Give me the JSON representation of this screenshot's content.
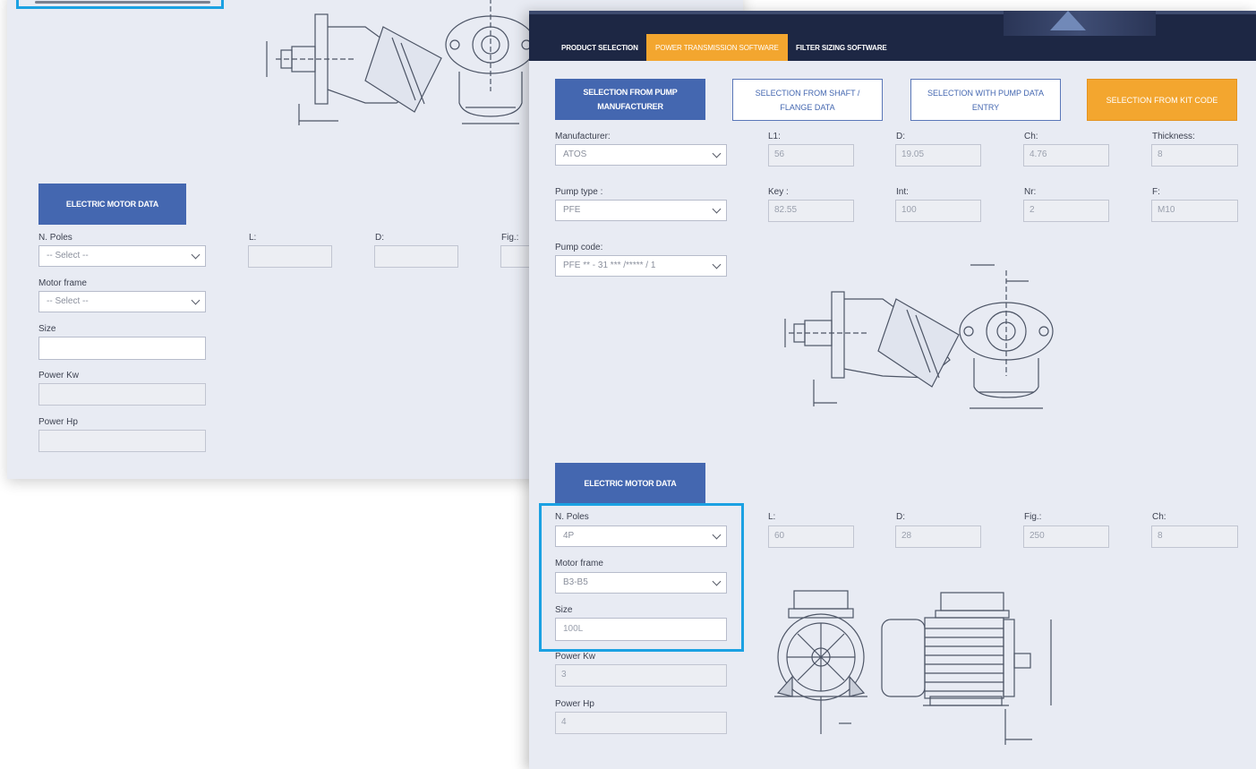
{
  "back_window": {
    "motor_button": "ELECTRIC MOTOR DATA",
    "poles_label": "N. Poles",
    "poles_value": "-- Select --",
    "frame_label": "Motor frame",
    "frame_value": "-- Select --",
    "size_label": "Size",
    "power_kw_label": "Power Kw",
    "power_hp_label": "Power Hp",
    "l_label": "L:",
    "d_label": "D:",
    "fig_label": "Fig.:"
  },
  "nav": {
    "items": [
      "PRODUCT SELECTION",
      "POWER TRANSMISSION SOFTWARE",
      "FILTER SIZING SOFTWARE"
    ],
    "active_index": 1
  },
  "selection_tabs": {
    "pump_manufacturer": "SELECTION FROM PUMP MANUFACTURER",
    "shaft_flange": "SELECTION FROM SHAFT / FLANGE DATA",
    "pump_data_entry": "SELECTION WITH PUMP DATA ENTRY",
    "kit_code": "SELECTION FROM KIT CODE"
  },
  "pump": {
    "manufacturer_label": "Manufacturer:",
    "manufacturer_value": "ATOS",
    "type_label": "Pump type :",
    "type_value": "PFE",
    "code_label": "Pump code:",
    "code_value": "PFE ** - 31 *** /***** / 1",
    "fields": [
      {
        "label": "L1:",
        "value": "56"
      },
      {
        "label": "D:",
        "value": "19.05"
      },
      {
        "label": "Ch:",
        "value": "4.76"
      },
      {
        "label": "Thickness:",
        "value": "8"
      },
      {
        "label": "Key :",
        "value": "82.55"
      },
      {
        "label": "Int:",
        "value": "100"
      },
      {
        "label": "Nr:",
        "value": "2"
      },
      {
        "label": "F:",
        "value": "M10"
      }
    ]
  },
  "motor": {
    "button": "ELECTRIC MOTOR DATA",
    "poles_label": "N. Poles",
    "poles_value": "4P",
    "frame_label": "Motor frame",
    "frame_value": "B3-B5",
    "size_label": "Size",
    "size_value": "100L",
    "power_kw_label": "Power Kw",
    "power_kw_value": "3",
    "power_hp_label": "Power Hp",
    "power_hp_value": "4",
    "fields": [
      {
        "label": "L:",
        "value": "60"
      },
      {
        "label": "D:",
        "value": "28"
      },
      {
        "label": "Fig.:",
        "value": "250"
      },
      {
        "label": "Ch:",
        "value": "8"
      }
    ]
  },
  "colors": {
    "accent_blue": "#4467b0",
    "accent_orange": "#f3a62f",
    "navbar": "#1d2744",
    "highlight": "#1ba1e2",
    "panel_bg": "#e8ebf3"
  }
}
